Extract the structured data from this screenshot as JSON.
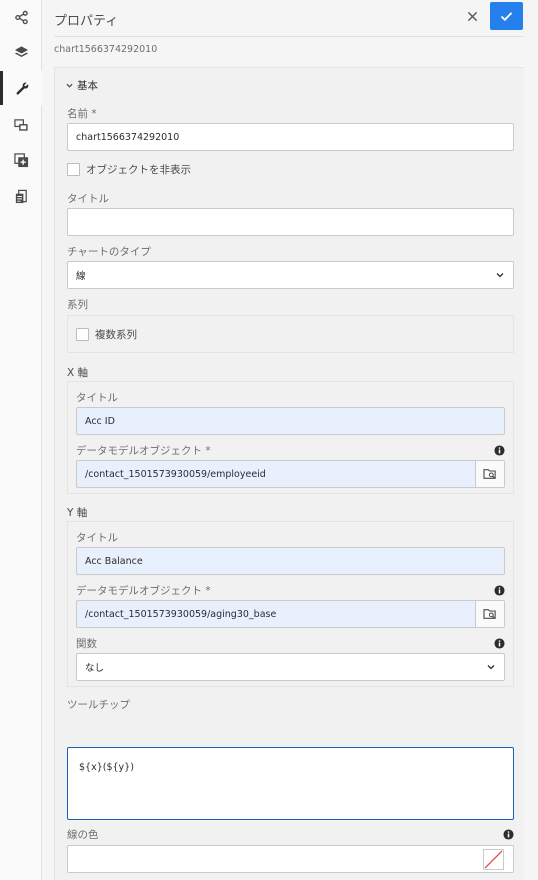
{
  "header": {
    "title": "プロパティ",
    "subtitle": "chart1566374292010"
  },
  "rail": {
    "items": [
      "share-icon",
      "layers-icon",
      "wrench-icon",
      "screens-icon",
      "add-fragment-icon",
      "clipboard-icon"
    ],
    "active": "wrench-icon"
  },
  "basic": {
    "section_label": "基本",
    "name_label": "名前 *",
    "name_value": "chart1566374292010",
    "hide_label": "オブジェクトを非表示",
    "title_label": "タイトル",
    "title_value": "",
    "chart_type_label": "チャートのタイプ",
    "chart_type_value": "線",
    "series_label": "系列",
    "multi_series_label": "複数系列"
  },
  "x_axis": {
    "label": "X 軸",
    "title_label": "タイトル",
    "title_value": "Acc ID",
    "model_label": "データモデルオブジェクト *",
    "model_value": "/contact_1501573930059/employeeid"
  },
  "y_axis": {
    "label": "Y 軸",
    "title_label": "タイトル",
    "title_value": "Acc Balance",
    "model_label": "データモデルオブジェクト *",
    "model_value": "/contact_1501573930059/aging30_base",
    "function_label": "関数",
    "function_value": "なし"
  },
  "tooltip": {
    "label": "ツールチップ",
    "value": "${x}(${y})"
  },
  "line_color": {
    "label": "線の色"
  },
  "colors": {
    "accent": "#2680eb",
    "focus": "#1f5db8",
    "swatch_slash": "#e34850"
  }
}
